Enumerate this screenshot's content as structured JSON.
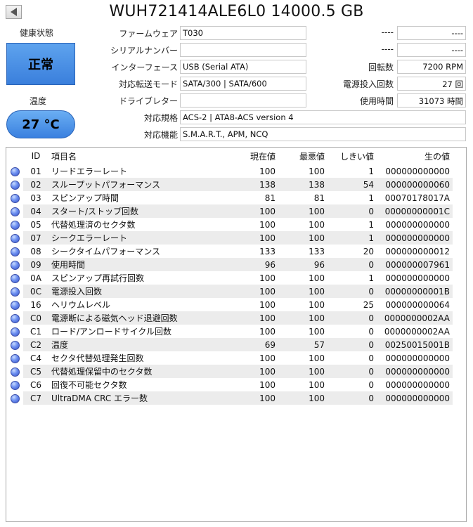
{
  "title": "WUH721414ALE6L0 14000.5 GB",
  "health": {
    "label": "健康状態",
    "status": "正常"
  },
  "temperature": {
    "label": "温度",
    "value": "27 °C"
  },
  "fields": {
    "firmware": {
      "label": "ファームウェア",
      "value": "T030"
    },
    "serial": {
      "label": "シリアルナンバー",
      "value": ""
    },
    "interface": {
      "label": "インターフェース",
      "value": "USB (Serial ATA)"
    },
    "transfer_mode": {
      "label": "対応転送モード",
      "value": "SATA/300 | SATA/600"
    },
    "drive_letter": {
      "label": "ドライブレター",
      "value": ""
    },
    "standard": {
      "label": "対応規格",
      "value": "ACS-2 | ATA8-ACS version 4"
    },
    "features": {
      "label": "対応機能",
      "value": "S.M.A.R.T., APM, NCQ"
    }
  },
  "right_fields": {
    "blank1": {
      "label": "----",
      "value": "----"
    },
    "blank2": {
      "label": "----",
      "value": "----"
    },
    "rotation": {
      "label": "回転数",
      "value": "7200 RPM"
    },
    "power_on_count": {
      "label": "電源投入回数",
      "value": "27 回"
    },
    "power_on_hours": {
      "label": "使用時間",
      "value": "31073 時間"
    }
  },
  "table": {
    "headers": {
      "id": "ID",
      "name": "項目名",
      "current": "現在値",
      "worst": "最悪値",
      "threshold": "しきい値",
      "raw": "生の値"
    },
    "rows": [
      {
        "id": "01",
        "name": "リードエラーレート",
        "current": "100",
        "worst": "100",
        "threshold": "1",
        "raw": "000000000000"
      },
      {
        "id": "02",
        "name": "スループットパフォーマンス",
        "current": "138",
        "worst": "138",
        "threshold": "54",
        "raw": "000000000060"
      },
      {
        "id": "03",
        "name": "スピンアップ時間",
        "current": "81",
        "worst": "81",
        "threshold": "1",
        "raw": "00070178017A"
      },
      {
        "id": "04",
        "name": "スタート/ストップ回数",
        "current": "100",
        "worst": "100",
        "threshold": "0",
        "raw": "00000000001C"
      },
      {
        "id": "05",
        "name": "代替処理済のセクタ数",
        "current": "100",
        "worst": "100",
        "threshold": "1",
        "raw": "000000000000"
      },
      {
        "id": "07",
        "name": "シークエラーレート",
        "current": "100",
        "worst": "100",
        "threshold": "1",
        "raw": "000000000000"
      },
      {
        "id": "08",
        "name": "シークタイムパフォーマンス",
        "current": "133",
        "worst": "133",
        "threshold": "20",
        "raw": "000000000012"
      },
      {
        "id": "09",
        "name": "使用時間",
        "current": "96",
        "worst": "96",
        "threshold": "0",
        "raw": "000000007961"
      },
      {
        "id": "0A",
        "name": "スピンアップ再試行回数",
        "current": "100",
        "worst": "100",
        "threshold": "1",
        "raw": "000000000000"
      },
      {
        "id": "0C",
        "name": "電源投入回数",
        "current": "100",
        "worst": "100",
        "threshold": "0",
        "raw": "00000000001B"
      },
      {
        "id": "16",
        "name": "ヘリウムレベル",
        "current": "100",
        "worst": "100",
        "threshold": "25",
        "raw": "000000000064"
      },
      {
        "id": "C0",
        "name": "電源断による磁気ヘッド退避回数",
        "current": "100",
        "worst": "100",
        "threshold": "0",
        "raw": "0000000002AA"
      },
      {
        "id": "C1",
        "name": "ロード/アンロードサイクル回数",
        "current": "100",
        "worst": "100",
        "threshold": "0",
        "raw": "0000000002AA"
      },
      {
        "id": "C2",
        "name": "温度",
        "current": "69",
        "worst": "57",
        "threshold": "0",
        "raw": "00250015001B"
      },
      {
        "id": "C4",
        "name": "セクタ代替処理発生回数",
        "current": "100",
        "worst": "100",
        "threshold": "0",
        "raw": "000000000000"
      },
      {
        "id": "C5",
        "name": "代替処理保留中のセクタ数",
        "current": "100",
        "worst": "100",
        "threshold": "0",
        "raw": "000000000000"
      },
      {
        "id": "C6",
        "name": "回復不可能セクタ数",
        "current": "100",
        "worst": "100",
        "threshold": "0",
        "raw": "000000000000"
      },
      {
        "id": "C7",
        "name": "UltraDMA CRC エラー数",
        "current": "100",
        "worst": "100",
        "threshold": "0",
        "raw": "000000000000"
      }
    ]
  }
}
